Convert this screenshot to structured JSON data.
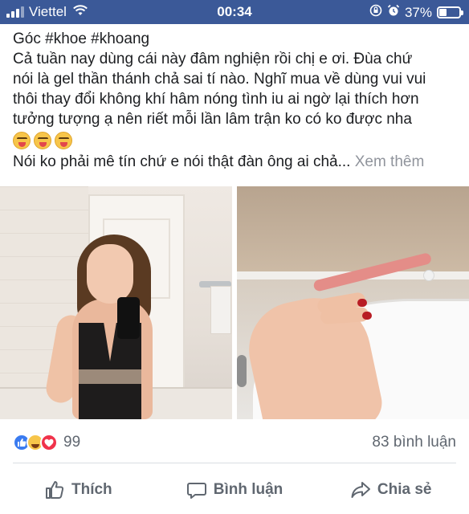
{
  "status_bar": {
    "carrier": "Viettel",
    "time": "00:34",
    "battery_percent": "37%",
    "battery_level": 0.37,
    "wifi_icon": "wifi-icon",
    "lock_icon": "rotation-lock-icon",
    "alarm_icon": "alarm-icon"
  },
  "post": {
    "lines": [
      "Góc #khoe #khoang",
      "Cả tuần nay dùng cái này đâm nghiện rồi chị e ơi. Đùa chứ",
      "nói là gel thần thánh chả sai tí nào. Nghĩ mua về dùng vui vui",
      "thôi thay đổi không khí hâm nóng tình iu ai ngờ lại thích hơn",
      "tưởng tượng ạ nên riết mỗi lần lâm trận ko có ko được nha"
    ],
    "last_line": "Nói ko phải mê tín chứ e nói thật đàn ông ai chả...",
    "see_more": "Xem thêm",
    "emoji_count": 3
  },
  "reactions": {
    "count": "99",
    "comments": "83 bình luận",
    "colors": {
      "like": "#3a7bf0",
      "haha": "#f7c54a",
      "love": "#f0334b"
    }
  },
  "actions": {
    "like": "Thích",
    "comment": "Bình luận",
    "share": "Chia sẻ"
  },
  "theme": {
    "status_bar_color": "#3b5998",
    "text_color": "#1c1e21",
    "muted_color": "#606770"
  }
}
